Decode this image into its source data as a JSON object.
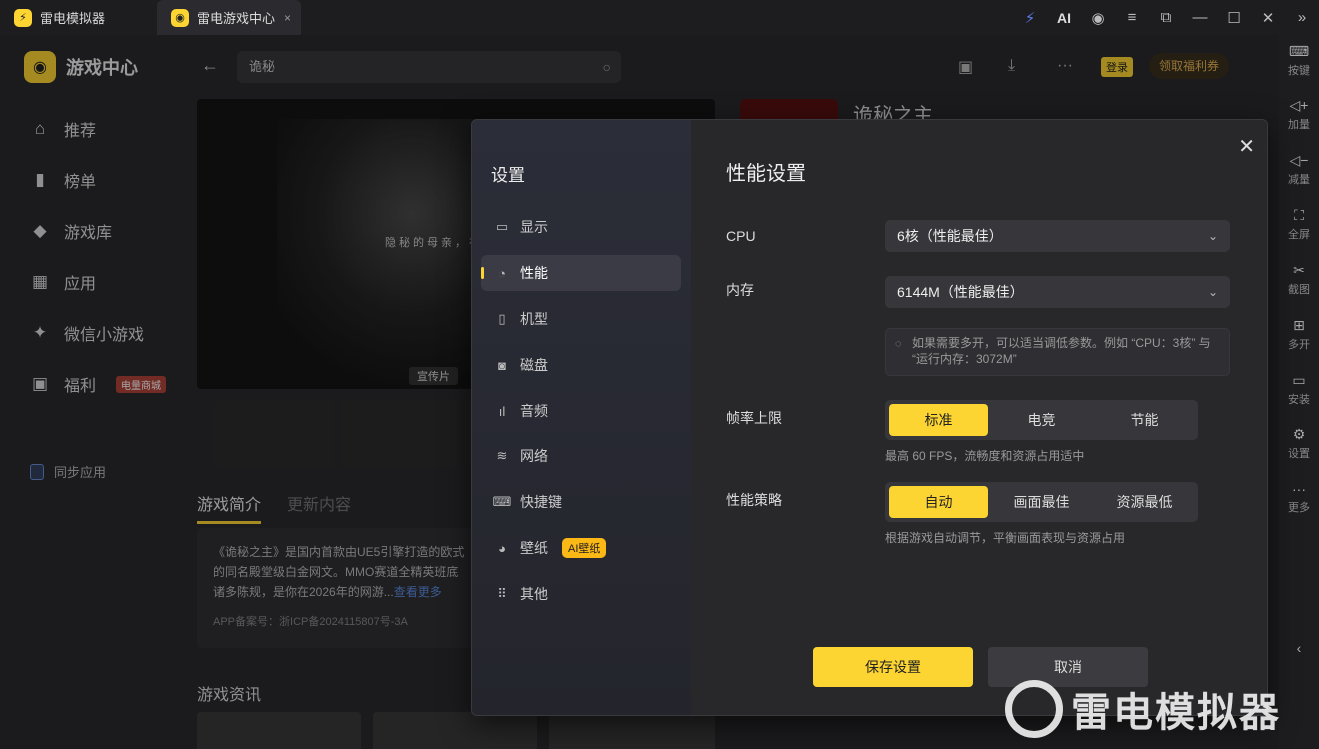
{
  "titlebar": {
    "tab1_label": "雷电模拟器",
    "tab2_label": "雷电游戏中心",
    "tab2_close": "×",
    "ai_label": "AI"
  },
  "app": {
    "brand": "游戏中心",
    "nav": [
      {
        "label": "推荐"
      },
      {
        "label": "榜单"
      },
      {
        "label": "游戏库"
      },
      {
        "label": "应用"
      },
      {
        "label": "微信小游戏"
      },
      {
        "label": "福利",
        "badge": "电量商城"
      }
    ],
    "sync_label": "同步应用",
    "search_value": "诡秘",
    "login_label": "登录",
    "gift_label": "领取福利券",
    "video_text": "隐秘的母亲，祈",
    "video_tag": "宣传片",
    "section_tabs": [
      "游戏简介",
      "更新内容"
    ],
    "intro_text": "《诡秘之主》是国内首款由UE5引擎打造的欧式",
    "intro_text2": "的同名殿堂级白金网文。MMO赛道全精英班底",
    "intro_text3": "诸多陈规，是你在2026年的网游...",
    "intro_more": "查看更多",
    "intro_icp": "APP备案号：浙ICP备2024115807号-3A",
    "news_title": "游戏资讯",
    "game_title": "诡秘之主"
  },
  "right_toolbar": [
    {
      "label": "按键",
      "icon": "keyboard-icon"
    },
    {
      "label": "加量",
      "icon": "volume-up-icon"
    },
    {
      "label": "减量",
      "icon": "volume-down-icon"
    },
    {
      "label": "全屏",
      "icon": "fullscreen-icon"
    },
    {
      "label": "截图",
      "icon": "scissors-icon"
    },
    {
      "label": "多开",
      "icon": "multi-instance-icon"
    },
    {
      "label": "安装",
      "icon": "apk-icon"
    },
    {
      "label": "设置",
      "icon": "gear-icon"
    },
    {
      "label": "更多",
      "icon": "more-icon"
    }
  ],
  "modal": {
    "side_title": "设置",
    "nav": [
      {
        "label": "显示",
        "icon": "monitor-icon"
      },
      {
        "label": "性能",
        "icon": "performance-icon",
        "active": true
      },
      {
        "label": "机型",
        "icon": "phone-icon"
      },
      {
        "label": "磁盘",
        "icon": "disk-icon"
      },
      {
        "label": "音频",
        "icon": "audio-icon"
      },
      {
        "label": "网络",
        "icon": "wifi-icon"
      },
      {
        "label": "快捷键",
        "icon": "keyboard-icon"
      },
      {
        "label": "壁纸",
        "icon": "palette-icon",
        "badge": "AI壁纸"
      },
      {
        "label": "其他",
        "icon": "grid-icon"
      }
    ],
    "title": "性能设置",
    "cpu_label": "CPU",
    "cpu_value": "6核（性能最佳）",
    "memory_label": "内存",
    "memory_value": "6144M（性能最佳）",
    "hint": "如果需要多开，可以适当调低参数。例如 “CPU：3核” 与 “运行内存：3072M”",
    "fps_label": "帧率上限",
    "fps_options": [
      "标准",
      "电竞",
      "节能"
    ],
    "fps_selected": "标准",
    "fps_desc": "最高 60 FPS，流畅度和资源占用适中",
    "strategy_label": "性能策略",
    "strategy_options": [
      "自动",
      "画面最佳",
      "资源最低"
    ],
    "strategy_selected": "自动",
    "strategy_desc": "根据游戏自动调节，平衡画面表现与资源占用",
    "save_label": "保存设置",
    "cancel_label": "取消"
  },
  "watermark": "雷电模拟器",
  "colors": {
    "accent": "#fcd532",
    "modal_bg": "#28282b",
    "sidebar_bg": "#2b2d38"
  }
}
